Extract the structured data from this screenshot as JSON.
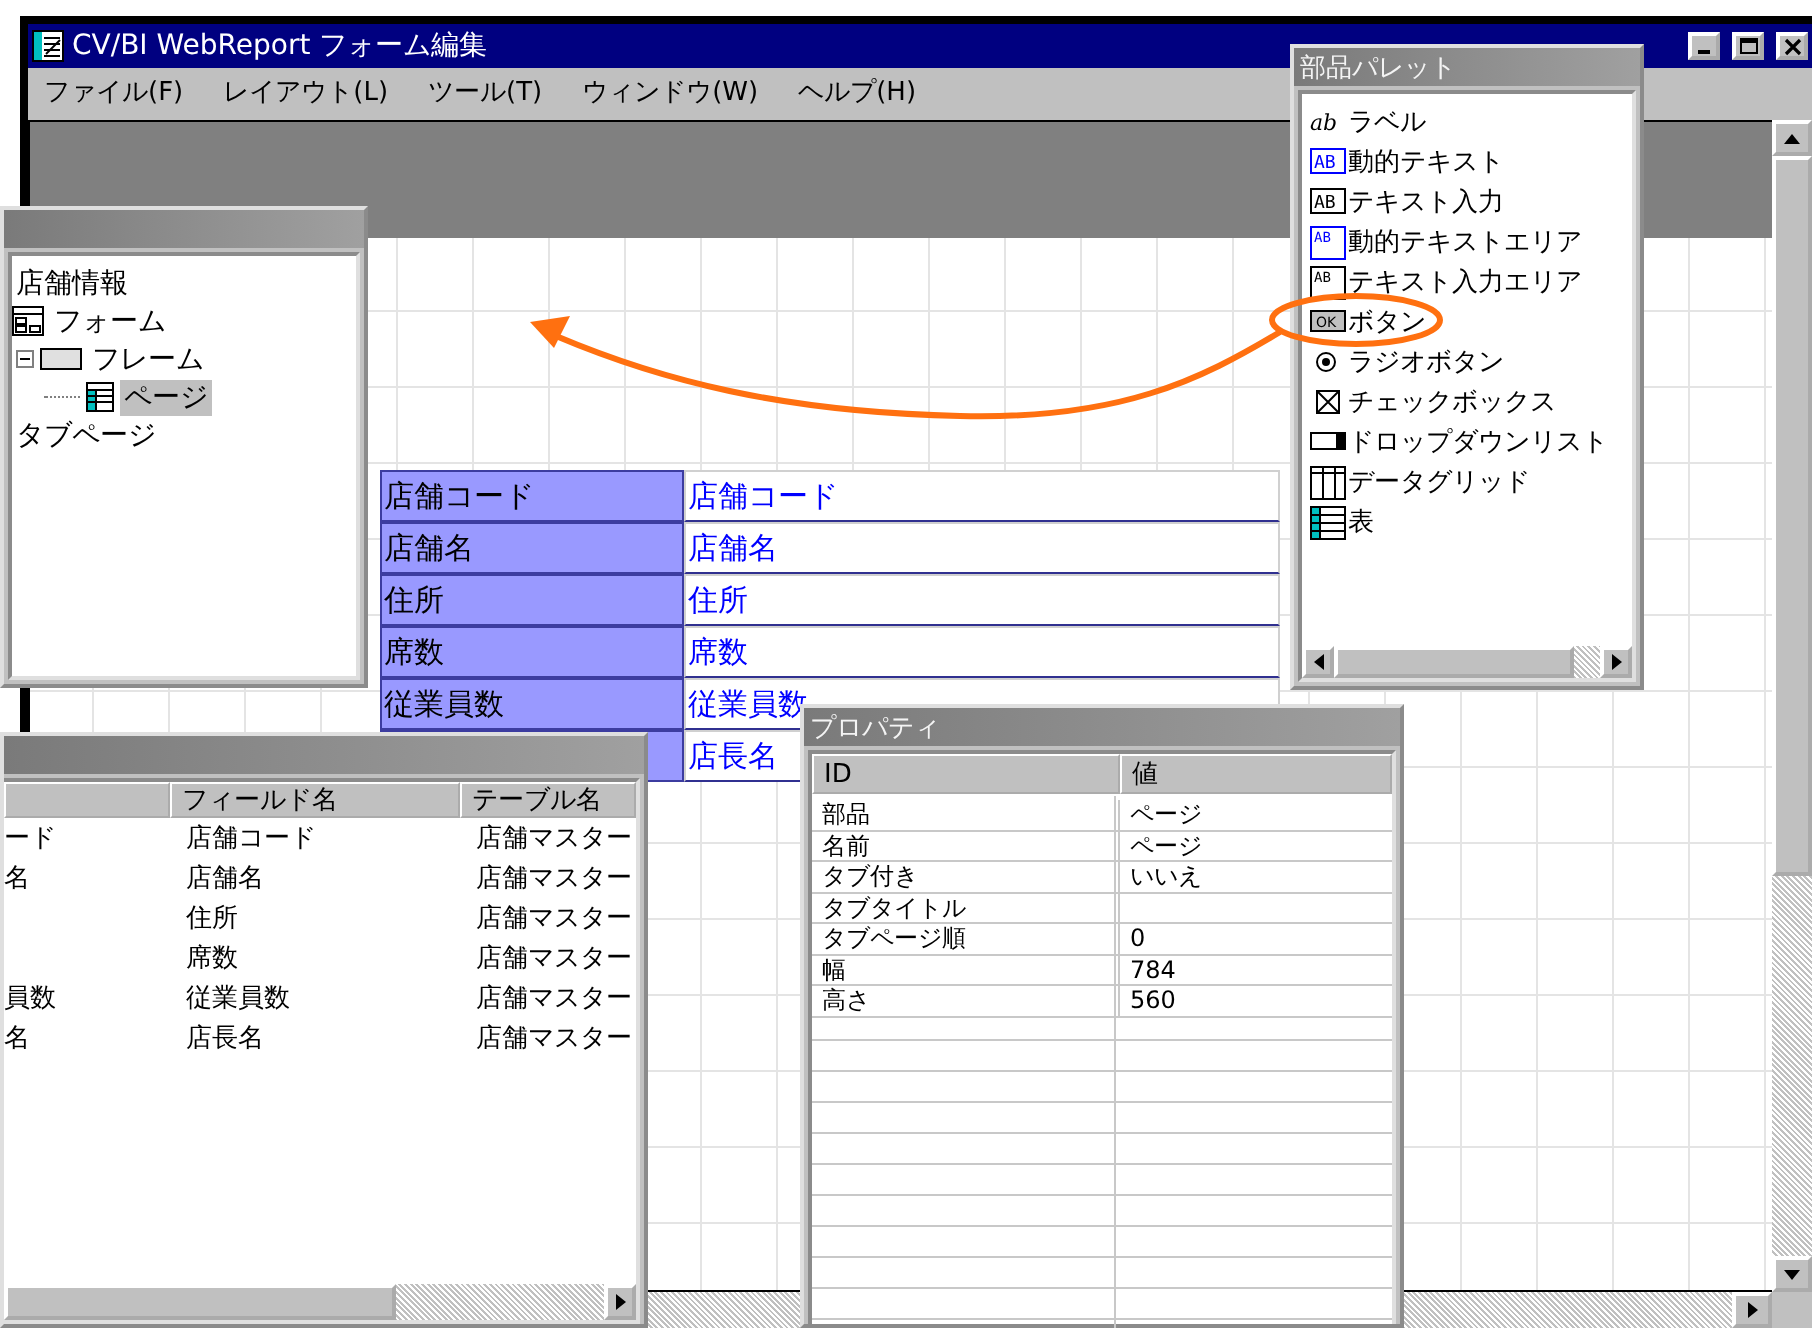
{
  "window": {
    "title": "CV/BI WebReport フォーム編集"
  },
  "menu": [
    {
      "label": "ファイル(F)"
    },
    {
      "label": "レイアウト(L)"
    },
    {
      "label": "ツール(T)"
    },
    {
      "label": "ウィンドウ(W)"
    },
    {
      "label": "ヘルプ(H)"
    }
  ],
  "tree": {
    "items": [
      {
        "label": "店舗情報",
        "kind": "text",
        "selected": false
      },
      {
        "label": "フォーム",
        "kind": "form",
        "selected": false,
        "children": [
          {
            "label": "フレーム",
            "kind": "frame",
            "selected": false,
            "expanded": true,
            "children": [
              {
                "label": "ページ",
                "kind": "page",
                "selected": true
              }
            ]
          }
        ]
      },
      {
        "label": "タブページ",
        "kind": "text",
        "selected": false
      }
    ]
  },
  "form_fields": [
    {
      "label": "店舗コード",
      "value": "店舗コード"
    },
    {
      "label": "店舗名",
      "value": "店舗名"
    },
    {
      "label": "住所",
      "value": "住所"
    },
    {
      "label": "席数",
      "value": "席数"
    },
    {
      "label": "従業員数",
      "value": "従業員数"
    },
    {
      "value": "店長名"
    }
  ],
  "palette": {
    "title": "部品パレット",
    "items": [
      {
        "label": "ラベル",
        "kind": "label",
        "icon_text": "ab"
      },
      {
        "label": "動的テキスト",
        "kind": "dynamic-text",
        "icon_text": "AB"
      },
      {
        "label": "テキスト入力",
        "kind": "text-input",
        "icon_text": "AB"
      },
      {
        "label": "動的テキストエリア",
        "kind": "dynamic-textarea",
        "icon_text": "AB"
      },
      {
        "label": "テキスト入力エリア",
        "kind": "textarea",
        "icon_text": "AB"
      },
      {
        "label": "ボタン",
        "kind": "button",
        "icon_text": "OK"
      },
      {
        "label": "ラジオボタン",
        "kind": "radio"
      },
      {
        "label": "チェックボックス",
        "kind": "checkbox"
      },
      {
        "label": "ドロップダウンリスト",
        "kind": "dropdown"
      },
      {
        "label": "データグリッド",
        "kind": "datagrid"
      },
      {
        "label": "表",
        "kind": "table"
      }
    ]
  },
  "fields": {
    "columns": [
      "フィールド名",
      "テーブル名"
    ],
    "rows": [
      {
        "column_1": "ード",
        "field": "店舗コード",
        "table": "店舗マスター"
      },
      {
        "column_1": "名",
        "field": "店舗名",
        "table": "店舗マスター"
      },
      {
        "field": "住所",
        "table": "店舗マスター"
      },
      {
        "field": "席数",
        "table": "店舗マスター"
      },
      {
        "column_1": "員数",
        "field": "従業員数",
        "table": "店舗マスター"
      },
      {
        "column_1": "名",
        "field": "店長名",
        "table": "店舗マスター"
      }
    ]
  },
  "properties": {
    "title": "プロパティ",
    "columns": [
      "ID",
      "値"
    ],
    "rows": [
      {
        "id": "部品",
        "value": "ページ"
      },
      {
        "id": "名前",
        "value": "ページ"
      },
      {
        "id": "タブ付き",
        "value": "いいえ"
      },
      {
        "id": "タブタイトル"
      },
      {
        "id": "タブページ順",
        "value": "0"
      },
      {
        "id": "幅",
        "value": "784"
      },
      {
        "id": "高さ",
        "value": "560"
      }
    ]
  }
}
